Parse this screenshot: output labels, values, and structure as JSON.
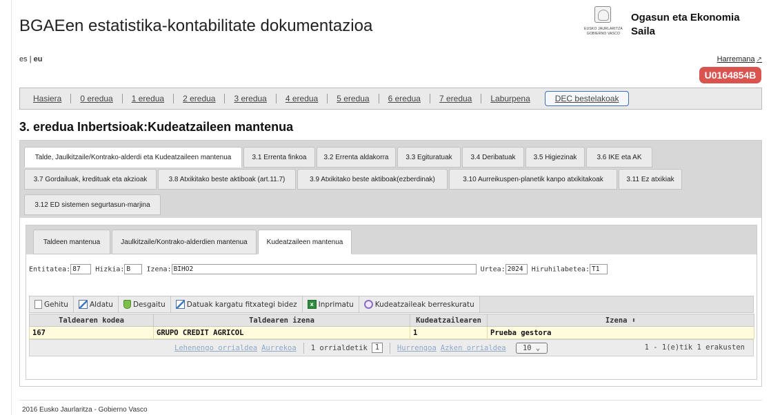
{
  "header": {
    "title": "BGAEen estatistika-kontabilitate dokumentazioa",
    "logo_line1": "EUSKO JAURLARITZA",
    "logo_line2": "GOBIERNO VASCO",
    "dept_line1": "Ogasun eta Ekonomia",
    "dept_line2": "Saila"
  },
  "lang": {
    "es": "es",
    "sep": "|",
    "eu": "eu"
  },
  "contact": {
    "label": "Harremana",
    "icon": "external-link-icon"
  },
  "user": {
    "code": "U0164854B",
    "color": "#d9534f"
  },
  "nav": {
    "items": [
      "Hasiera",
      "0 eredua",
      "1 eredua",
      "2 eredua",
      "3 eredua",
      "4 eredua",
      "5 eredua",
      "6 eredua",
      "7 eredua",
      "Laburpena",
      "DEC bestelakoak"
    ],
    "active": "DEC bestelakoak"
  },
  "page_title": "3. eredua Inbertsioak:Kudeatzaileen mantenua",
  "outer_tabs": [
    "Talde, Jaulkitzaile/Kontrako-alderdi eta Kudeatzaileen mantenua",
    "3.1 Errenta finkoa",
    "3.2 Errenta aldakorra",
    "3.3 Egituratuak",
    "3.4 Deribatuak",
    "3.5 Higiezinak",
    "3.6 IKE eta AK",
    "3.7 Gordailuak, kredituak eta akzioak",
    "3.8 Atxikitako beste aktiboak (art.11.7)",
    "3.9 Atxikitako beste aktiboak(ezberdinak)",
    "3.10 Aurreikuspen-planetik kanpo atxikitakoak",
    "3.11 Ez atxikiak",
    "3.12 ED sistemen segurtasun-marjina"
  ],
  "inner_tabs": [
    "Taldeen mantenua",
    "Jaulkitzaile/Kontrako-alderdien mantenua",
    "Kudeatzaileen mantenua"
  ],
  "filters": {
    "entitatea_label": "Entitatea:",
    "entitatea": "87",
    "hizkia_label": "Hizkia:",
    "hizkia": "B",
    "izena_label": "Izena:",
    "izena": "BIHO2",
    "urtea_label": "Urtea:",
    "urtea": "2024",
    "hiruhilabetea_label": "Hiruhilabetea:",
    "hiruhilabetea": "T1"
  },
  "toolbar": {
    "gehitu": "Gehitu",
    "aldatu": "Aldatu",
    "desgaitu": "Desgaitu",
    "kargatu": "Datuak kargatu fitxategi bidez",
    "inprimatu": "Inprimatu",
    "berreskuratu": "Kudeatzaileak berreskuratu"
  },
  "table": {
    "headers": [
      "Taldearen kodea",
      "Taldearen izena",
      "Kudeatzailearen",
      "Izena ⬍"
    ],
    "rows": [
      [
        "167",
        "GRUPO CREDIT AGRICOL",
        "1",
        "Prueba gestora"
      ]
    ]
  },
  "pager": {
    "first": "Lehenengo orrialdea",
    "prev": "Aurrekoa",
    "page_label": "1 orrialdetik",
    "page": "1",
    "next": "Hurrengoa",
    "last": "Azken orrialdea",
    "page_size": "10 ⌄",
    "info": "1 - 1(e)tik 1 erakusten"
  },
  "footer": "2016 Eusko Jaurlaritza - Gobierno Vasco"
}
